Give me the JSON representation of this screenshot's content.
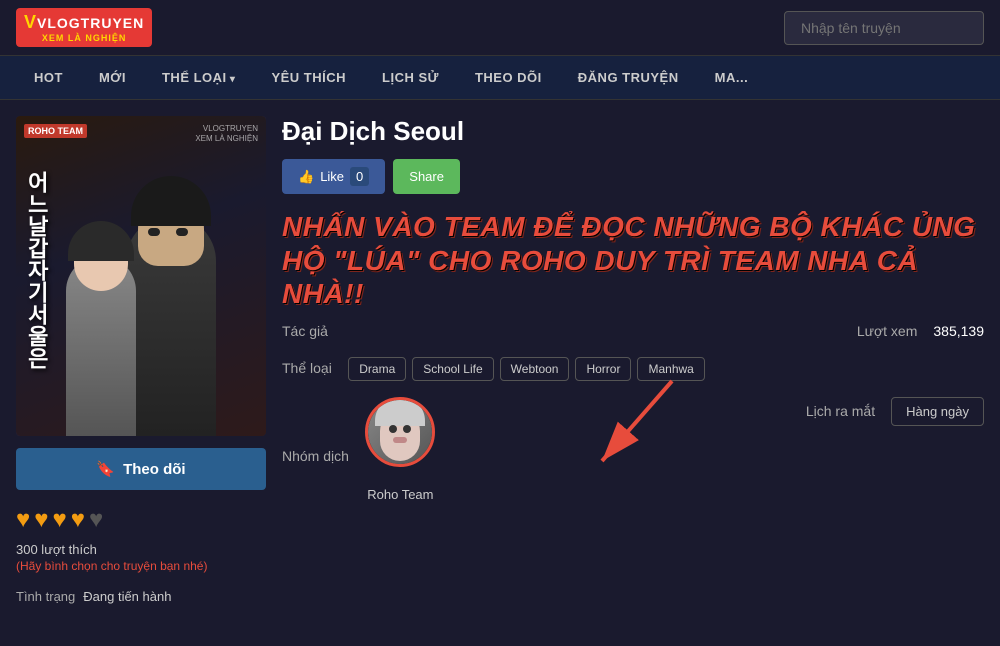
{
  "header": {
    "logo_top": "VLOGTRUYEN",
    "logo_v": "V",
    "logo_bottom": "XEM LÀ NGHIỆN",
    "search_placeholder": "Nhập tên truyện"
  },
  "nav": {
    "items": [
      {
        "label": "HOT",
        "active": false,
        "has_arrow": false
      },
      {
        "label": "MỚI",
        "active": false,
        "has_arrow": false
      },
      {
        "label": "THỂ LOẠI",
        "active": false,
        "has_arrow": true
      },
      {
        "label": "YÊU THÍCH",
        "active": false,
        "has_arrow": false
      },
      {
        "label": "LỊCH SỬ",
        "active": false,
        "has_arrow": false
      },
      {
        "label": "THEO DÕI",
        "active": false,
        "has_arrow": false
      },
      {
        "label": "ĐĂNG TRUYỆN",
        "active": false,
        "has_arrow": false
      },
      {
        "label": "MA...",
        "active": false,
        "has_arrow": false
      }
    ]
  },
  "manga": {
    "title": "Đại Dịch Seoul",
    "cover_watermark_line1": "VLOGTRUYEN",
    "cover_watermark_line2": "XEM LÀ NGHIỆN",
    "cover_roho_badge": "ROHO TEAM",
    "cover_korean_text": "어느날갑자기서울은",
    "like_count": "0",
    "like_label": "Like",
    "share_label": "Share",
    "promo_text_line1": "NHẤN VÀO TEAM ĐỂ ĐỌC NHỮNG BỘ KHÁC ỦNG",
    "promo_text_line2": "HỘ \"LÚA\" CHO ROHO DUY TRÌ TEAM NHA CẢ NHÀ!!",
    "author_label": "Tác giả",
    "author_value": "",
    "views_label": "Lượt xem",
    "views_value": "385,139",
    "genre_label": "Thể loại",
    "genres": [
      {
        "name": "Drama"
      },
      {
        "name": "School Life"
      },
      {
        "name": "Webtoon"
      },
      {
        "name": "Horror"
      },
      {
        "name": "Manhwa"
      }
    ],
    "translator_label": "Nhóm dịch",
    "translator_name": "Roho Team",
    "release_label": "Lịch ra mắt",
    "release_value": "Hàng ngày",
    "follow_label": "Theo dõi",
    "follow_icon": "🔖",
    "hearts": [
      true,
      true,
      true,
      true,
      false
    ],
    "likes_count_label": "300 lượt thích",
    "likes_prompt": "(Hãy bình chọn cho truyện bạn nhé)",
    "status_label": "Tình trạng",
    "status_value": "Đang tiến hành"
  }
}
